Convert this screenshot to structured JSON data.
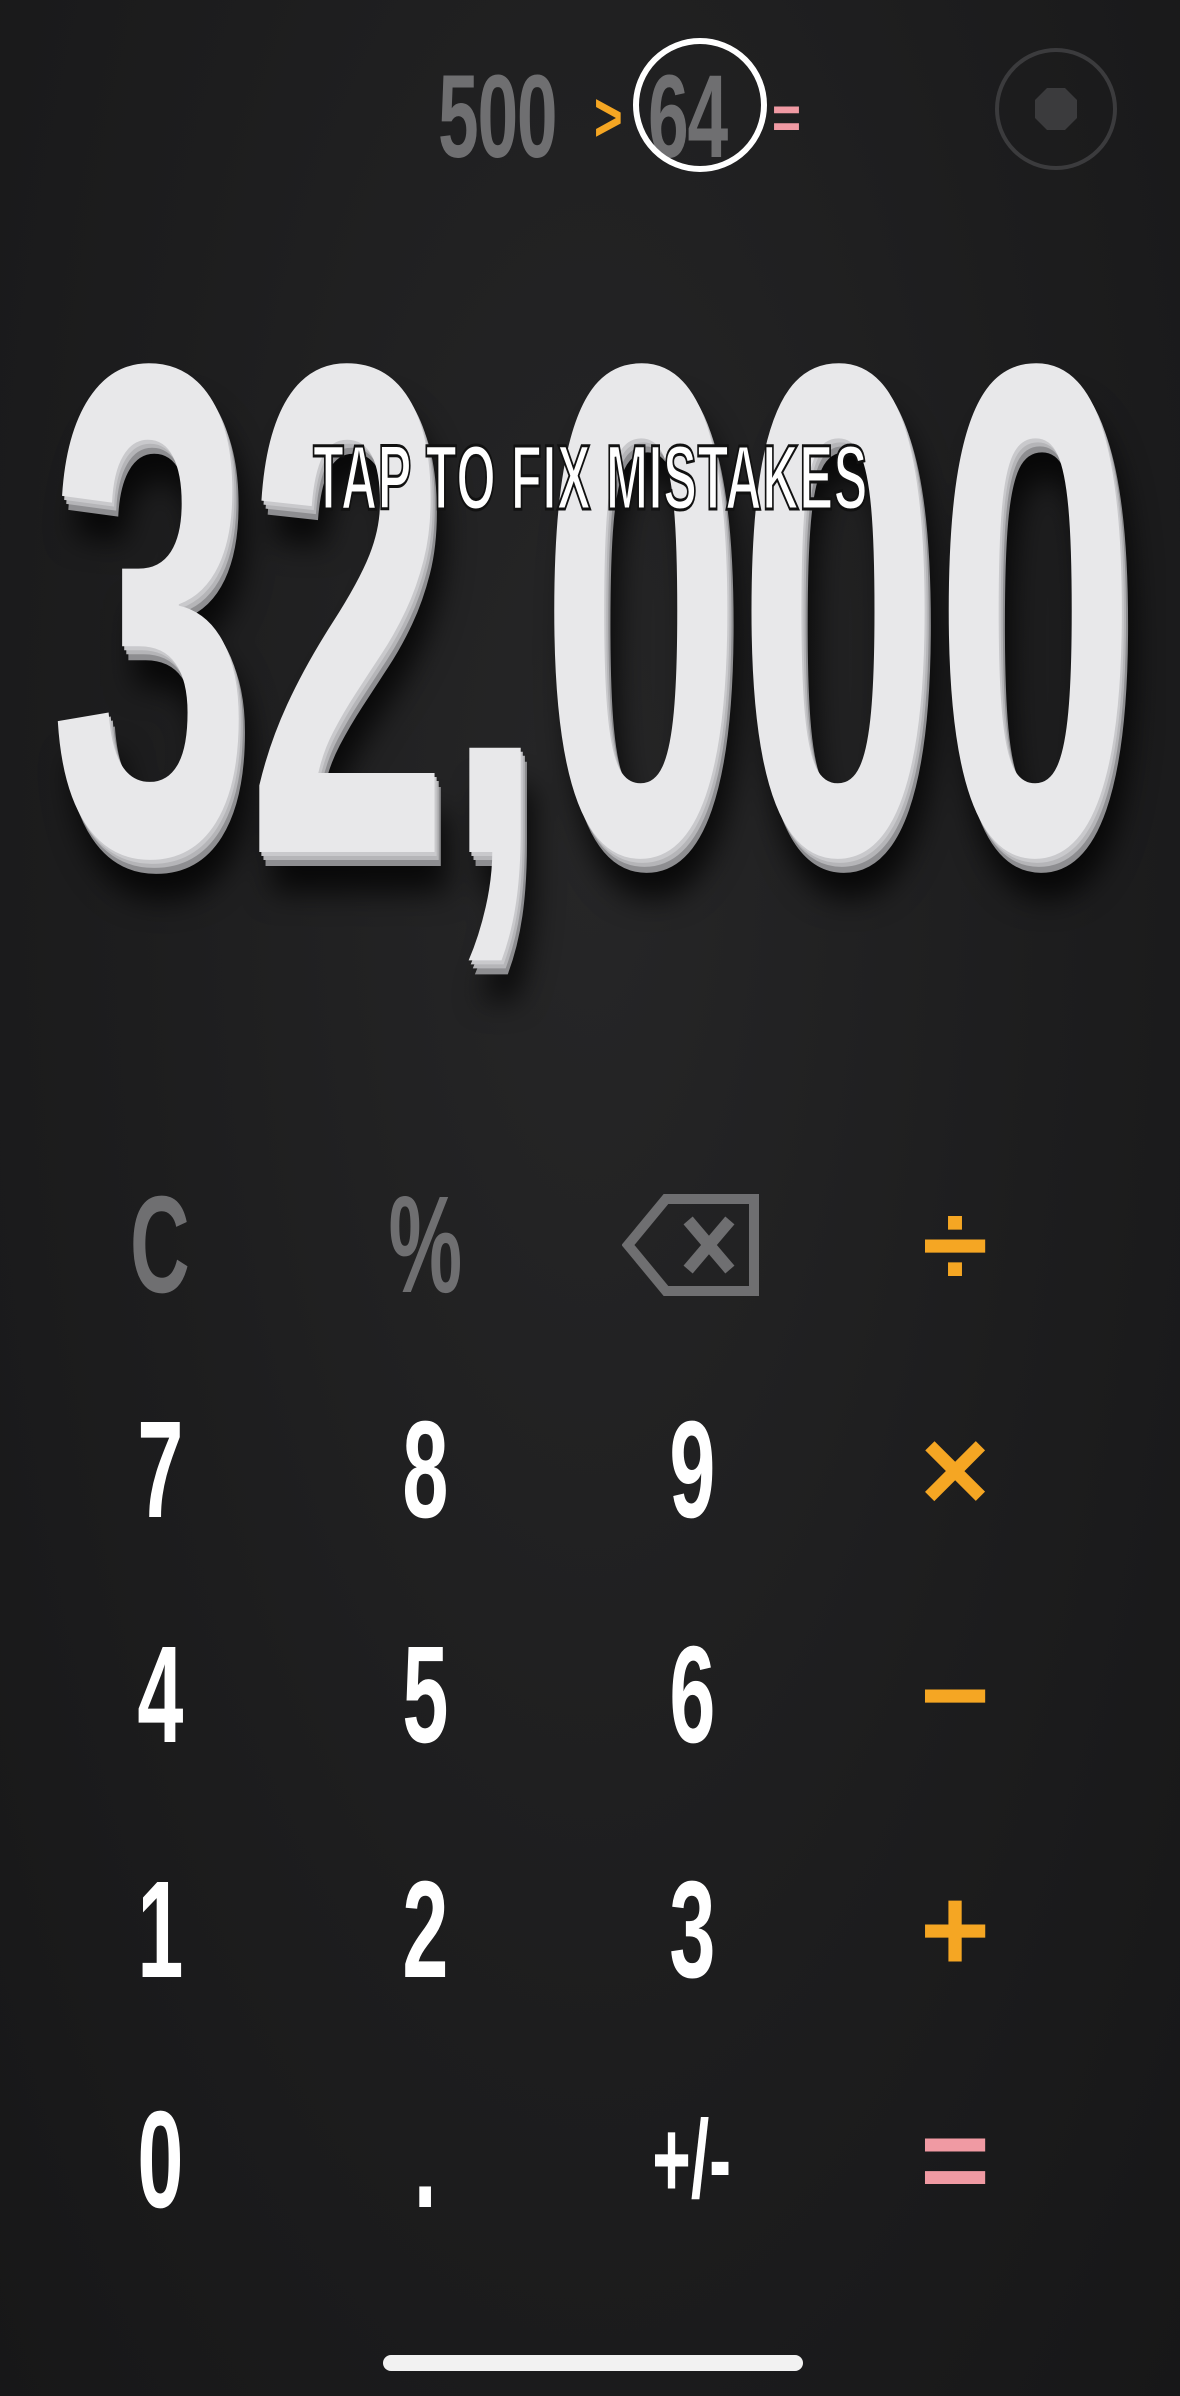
{
  "expression": {
    "operand_a": "500",
    "operator": ">",
    "operand_b": "64",
    "equals": "="
  },
  "result": {
    "value": "32,000",
    "hint": "TAP TO FIX MISTAKES"
  },
  "keypad": {
    "rows": [
      [
        "C",
        "%",
        "backspace",
        "÷"
      ],
      [
        "7",
        "8",
        "9",
        "×"
      ],
      [
        "4",
        "5",
        "6",
        "−"
      ],
      [
        "1",
        "2",
        "3",
        "+"
      ],
      [
        "0",
        ".",
        "+/-",
        "="
      ]
    ],
    "labels": {
      "clear": "C",
      "percent": "%",
      "divide": "÷",
      "seven": "7",
      "eight": "8",
      "nine": "9",
      "multiply": "×",
      "four": "4",
      "five": "5",
      "six": "6",
      "minus": "−",
      "one": "1",
      "two": "2",
      "three": "3",
      "plus": "+",
      "zero": "0",
      "decimal": ".",
      "sign": "+/-",
      "equals": "="
    },
    "icons": {
      "backspace": "backspace-icon",
      "settings": "record-dot-icon"
    }
  },
  "colors": {
    "background": "#1f1f20",
    "digit": "#ffffff",
    "function_key": "#6f6f71",
    "operator": "#f5a623",
    "equals": "#f09aa3",
    "result": "#e8e8ea"
  }
}
